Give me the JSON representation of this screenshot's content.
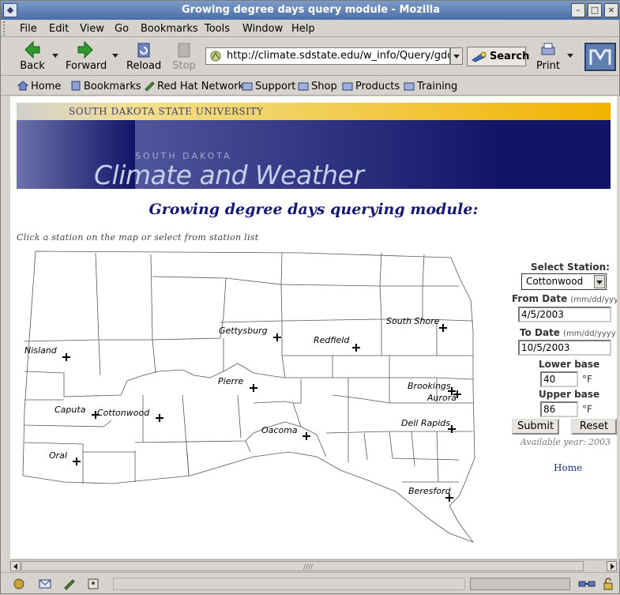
{
  "window": {
    "title": "Growing degree days query module - Mozilla",
    "minimize_glyph": "–",
    "maximize_glyph": "□",
    "close_glyph": "×"
  },
  "menubar": {
    "items": [
      "File",
      "Edit",
      "View",
      "Go",
      "Bookmarks",
      "Tools",
      "Window",
      "Help"
    ]
  },
  "navbar": {
    "back": "Back",
    "forward": "Forward",
    "reload": "Reload",
    "stop": "Stop",
    "url": "http://climate.sdstate.edu/w_info/Query/gddfr.ht",
    "search": "Search",
    "print": "Print"
  },
  "personalbar": {
    "items": [
      "Home",
      "Bookmarks",
      "Red Hat Network",
      "Support",
      "Shop",
      "Products",
      "Training"
    ]
  },
  "banner": {
    "university": "SOUTH DAKOTA STATE UNIVERSITY",
    "state": "SOUTH DAKOTA",
    "heading": "Climate and Weather",
    "colors": {
      "navy": "#111568",
      "gold": "#f2b200"
    }
  },
  "page": {
    "title": "Growing degree days querying module:",
    "instruction": "Click a station on the map or select from station list"
  },
  "map": {
    "stations": [
      "Gettysburg",
      "South Shore",
      "Redfield",
      "Nisland",
      "Pierre",
      "Brookings",
      "Aurora",
      "Caputa",
      "Cottonwood",
      "Oacoma",
      "Dell Rapids",
      "Oral",
      "Beresford"
    ]
  },
  "form": {
    "select_station_label": "Select Station:",
    "selected_station": "Cottonwood",
    "from_date_label": "From Date",
    "date_hint": "(mm/dd/yyyy)",
    "from_date": "4/5/2003",
    "to_date_label": "To Date",
    "to_date": "10/5/2003",
    "lower_base_label": "Lower base",
    "lower_base": "40",
    "upper_base_label": "Upper base",
    "upper_base": "86",
    "unit": "°F",
    "submit": "Submit",
    "reset": "Reset",
    "available_year": "Available year: 2003",
    "home_link": "Home"
  }
}
